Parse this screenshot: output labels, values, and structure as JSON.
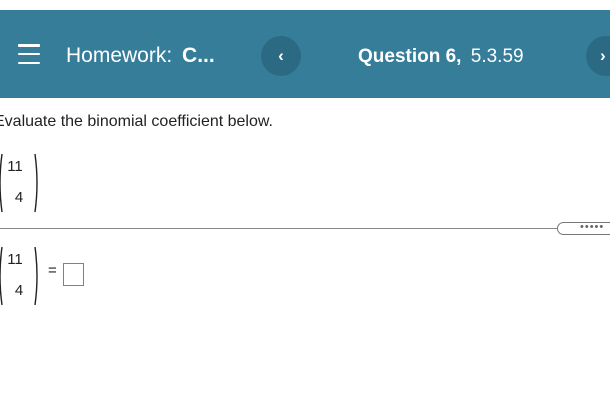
{
  "header": {
    "homework_label": "Homework:",
    "homework_name": "C...",
    "question_label": "Question 6,",
    "question_number": "5.3.59",
    "prev_symbol": "‹",
    "next_symbol": "›"
  },
  "question": {
    "instruction": "Evaluate the binomial coefficient below.",
    "binomial_display": {
      "n": "11",
      "k": "4"
    }
  },
  "more_handle_label": "•••••",
  "answer": {
    "binomial": {
      "n": "11",
      "k": "4"
    },
    "equals": "=",
    "value": ""
  },
  "colors": {
    "header_bg": "#357d98",
    "nav_button_bg": "#2b6a82",
    "answer_box_border": "#4a90c2"
  }
}
